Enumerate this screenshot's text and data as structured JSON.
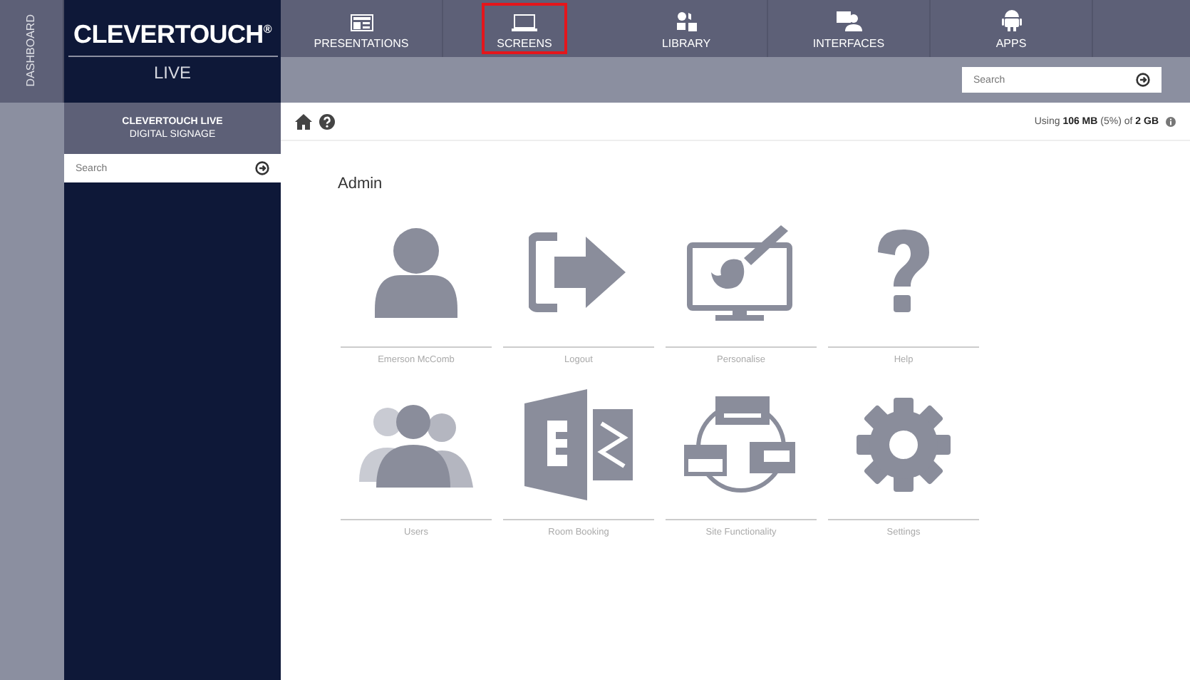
{
  "dashboard_tab": {
    "label": "DASHBOARD"
  },
  "logo": {
    "title": "CLEVERTOUCH$^{®}$",
    "subtitle": "LIVE"
  },
  "nav_tabs": [
    {
      "label": "PRESENTATIONS",
      "kind": "presentations",
      "selected": false
    },
    {
      "label": "SCREENS",
      "kind": "screens",
      "selected": true
    },
    {
      "label": "LIBRARY",
      "kind": "library",
      "selected": false
    },
    {
      "label": "INTERFACES",
      "kind": "interfaces",
      "selected": false
    },
    {
      "label": "APPS",
      "kind": "apps",
      "selected": false
    }
  ],
  "top_search": {
    "placeholder": "Search"
  },
  "sidebar": {
    "title": "CLEVERTOUCH LIVE",
    "subtitle": "DIGITAL SIGNAGE",
    "search": {
      "placeholder": "Search"
    }
  },
  "usage": "Using **106 MB** (5%) of **2 GB**",
  "section_title": "Admin",
  "tiles": [
    {
      "label": "Emerson McComb",
      "kind": "user"
    },
    {
      "label": "Logout",
      "kind": "logout"
    },
    {
      "label": "Personalise",
      "kind": "personalise"
    },
    {
      "label": "Help",
      "kind": "help"
    },
    {
      "label": "Users",
      "kind": "users"
    },
    {
      "label": "Room Booking",
      "kind": "booking"
    },
    {
      "label": "Site Functionality",
      "kind": "site"
    },
    {
      "label": "Settings",
      "kind": "settings"
    }
  ]
}
